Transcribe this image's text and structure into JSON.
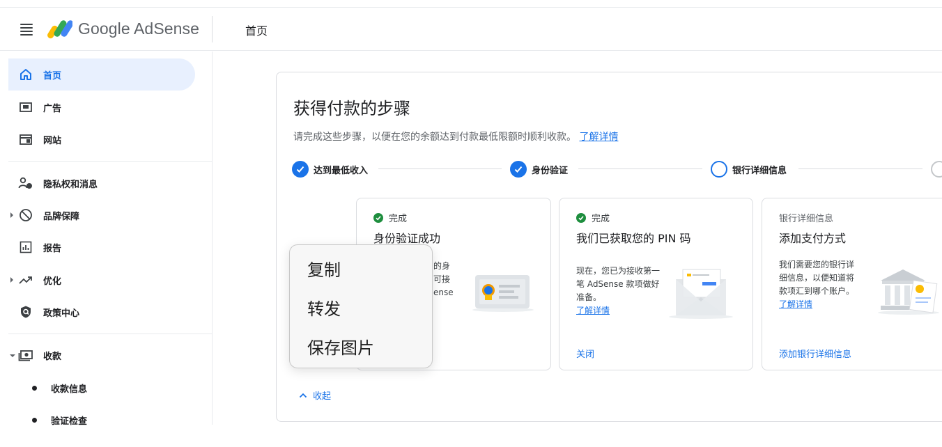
{
  "header": {
    "brand": "Google AdSense",
    "page_title": "首页",
    "icons": [
      "menu-icon",
      "adsense-logo"
    ]
  },
  "sidebar": {
    "items": [
      {
        "label": "首页",
        "icon": "home-icon",
        "active": true
      },
      {
        "label": "广告",
        "icon": "ads-icon"
      },
      {
        "label": "网站",
        "icon": "sites-icon"
      },
      {
        "label": "隐私权和消息",
        "icon": "privacy-icon"
      },
      {
        "label": "品牌保障",
        "icon": "block-icon",
        "expandable": true
      },
      {
        "label": "报告",
        "icon": "report-icon"
      },
      {
        "label": "优化",
        "icon": "trend-icon",
        "expandable": true
      },
      {
        "label": "政策中心",
        "icon": "shield-icon"
      },
      {
        "label": "收款",
        "icon": "payments-icon",
        "expanded": true
      }
    ],
    "sub_items": [
      {
        "label": "收款信息"
      },
      {
        "label": "验证检查"
      }
    ]
  },
  "payment_steps": {
    "title": "获得付款的步骤",
    "description": "请完成这些步骤，以便在您的余额达到付款最低限额时顺利收款。",
    "learn_more": "了解详情",
    "steps": [
      {
        "label": "达到最低收入",
        "status": "done"
      },
      {
        "label": "身份验证",
        "status": "done"
      },
      {
        "label": "银行详细信息",
        "status": "current"
      }
    ],
    "cards": [
      {
        "status": "完成",
        "title": "身份验证成功",
        "body_fragments": [
          "的身",
          "可接",
          "ense"
        ]
      },
      {
        "status": "完成",
        "title": "我们已获取您的 PIN 码",
        "body": "现在，您已为接收第一笔 AdSense 款项做好准备。",
        "link": "了解详情",
        "action": "关闭"
      },
      {
        "status": "银行详细信息",
        "title": "添加支付方式",
        "body": "我们需要您的银行详细信息，以便知道将款项汇到哪个账户。",
        "link": "了解详情",
        "action": "添加银行详细信息"
      }
    ],
    "collapse_label": "收起"
  },
  "context_menu": {
    "items": [
      "复制",
      "转发",
      "保存图片"
    ]
  },
  "colors": {
    "accent": "#1a73e8",
    "active_bg": "#e8f0fe",
    "success": "#1e8e3e",
    "border": "#dadce0"
  }
}
